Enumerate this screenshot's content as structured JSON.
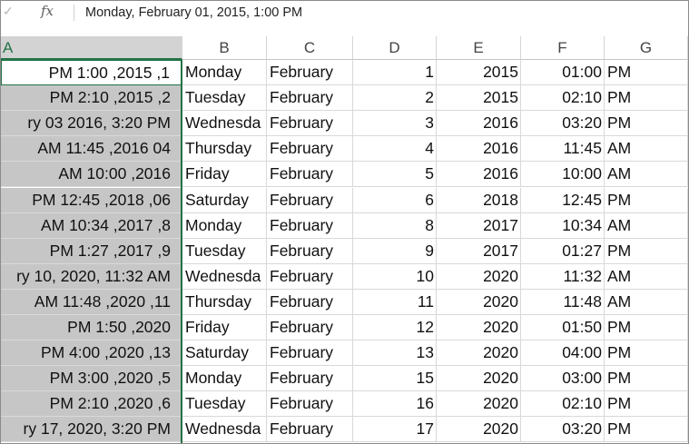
{
  "formula_bar": {
    "check_glyph": "✓",
    "fx_label": "fx",
    "content": "Monday, February 01, 2015, 1:00 PM"
  },
  "columns": [
    "A",
    "B",
    "C",
    "D",
    "E",
    "F",
    "G"
  ],
  "selected_column": "A",
  "rows": [
    {
      "a": "1, 2015, 1:00 PM",
      "b": "Monday",
      "c": "February",
      "d": "1",
      "e": "2015",
      "f": "01:00",
      "g": "PM"
    },
    {
      "a": "2, 2015, 2:10 PM",
      "b": "Tuesday",
      "c": "February",
      "d": "2",
      "e": "2015",
      "f": "02:10",
      "g": "PM"
    },
    {
      "a": "ry 03 2016, 3:20 PM",
      "b": "Wednesda",
      "c": "February",
      "d": "3",
      "e": "2016",
      "f": "03:20",
      "g": "PM"
    },
    {
      "a": "04 2016, 11:45 AM",
      "b": "Thursday",
      "c": "February",
      "d": "4",
      "e": "2016",
      "f": "11:45",
      "g": "AM"
    },
    {
      "a": "2016, 10:00 AM",
      "b": "Friday",
      "c": "February",
      "d": "5",
      "e": "2016",
      "f": "10:00",
      "g": "AM"
    },
    {
      "a": "06, 2018, 12:45 PM",
      "b": "Saturday",
      "c": "February",
      "d": "6",
      "e": "2018",
      "f": "12:45",
      "g": "PM"
    },
    {
      "a": "8, 2017, 10:34 AM",
      "b": "Monday",
      "c": "February",
      "d": "8",
      "e": "2017",
      "f": "10:34",
      "g": "AM"
    },
    {
      "a": "9, 2017, 1:27 PM",
      "b": "Tuesday",
      "c": "February",
      "d": "9",
      "e": "2017",
      "f": "01:27",
      "g": "PM"
    },
    {
      "a": "ry 10, 2020, 11:32 AM",
      "b": "Wednesda",
      "c": "February",
      "d": "10",
      "e": "2020",
      "f": "11:32",
      "g": "AM"
    },
    {
      "a": "11, 2020, 11:48 AM",
      "b": "Thursday",
      "c": "February",
      "d": "11",
      "e": "2020",
      "f": "11:48",
      "g": "AM"
    },
    {
      "a": "2020, 1:50 PM",
      "b": "Friday",
      "c": "February",
      "d": "12",
      "e": "2020",
      "f": "01:50",
      "g": "PM"
    },
    {
      "a": "13, 2020, 4:00 PM",
      "b": "Saturday",
      "c": "February",
      "d": "13",
      "e": "2020",
      "f": "04:00",
      "g": "PM"
    },
    {
      "a": "5, 2020, 3:00 PM",
      "b": "Monday",
      "c": "February",
      "d": "15",
      "e": "2020",
      "f": "03:00",
      "g": "PM"
    },
    {
      "a": "6, 2020, 2:10 PM",
      "b": "Tuesday",
      "c": "February",
      "d": "16",
      "e": "2020",
      "f": "02:10",
      "g": "PM"
    },
    {
      "a": "ry 17, 2020, 3:20 PM",
      "b": "Wednesda",
      "c": "February",
      "d": "17",
      "e": "2020",
      "f": "03:20",
      "g": "PM"
    }
  ]
}
